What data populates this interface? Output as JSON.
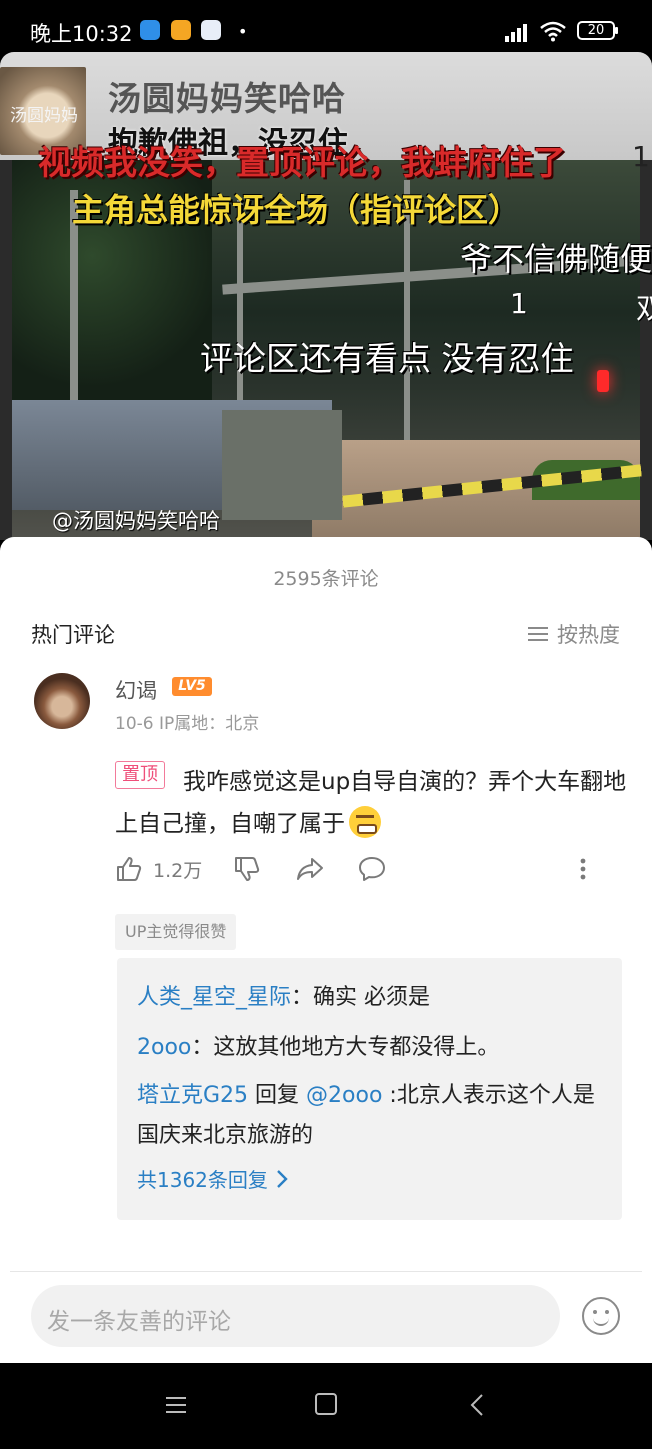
{
  "status_bar": {
    "time": "晚上10:32",
    "dot": "•",
    "battery": "20"
  },
  "video": {
    "channel_name": "汤圆妈妈笑哈哈",
    "avatar_text": "汤圆妈妈",
    "overlay_line1": "抱歉佛祖，没忍住",
    "overlay_red": "视频我没笑，置顶评论，我蚌府住了",
    "overlay_red_num": "1",
    "overlay_yellow": "主角总能惊讶全场（指评论区）",
    "overlay_white_right": "爷不信佛随便",
    "overlay_num": "1",
    "overlay_han": "双",
    "overlay_white_mid": "评论区还有看点  没有忍住",
    "watermark": "@汤圆妈妈笑哈哈"
  },
  "comments": {
    "count_label": "2595条评论",
    "section_title": "热门评论",
    "sort_label": "按热度",
    "top_comment": {
      "user": "幻谒",
      "level": "LV5",
      "meta": "10-6  IP属地：北京",
      "pin_label": "置顶",
      "text": "我咋感觉这是up自导自演的？弄个大车翻地上自己撞，自嘲了属于",
      "likes": "1.2万",
      "up_badge": "UP主觉得很赞",
      "replies": [
        {
          "user": "人类_星空_星际",
          "text": "：确实  必须是"
        },
        {
          "user": "2ooo",
          "text": "：这放其他地方大专都没得上。"
        },
        {
          "user": "塔立克G25",
          "verb": " 回复 ",
          "mention": "@2ooo",
          "text": " :北京人表示这个人是国庆来北京旅游的"
        }
      ],
      "more_replies": "共1362条回复"
    },
    "input_placeholder": "发一条友善的评论"
  },
  "colors": {
    "link": "#2a7fc4",
    "pin": "#ef4f7a",
    "level": "#ff8c2e"
  }
}
